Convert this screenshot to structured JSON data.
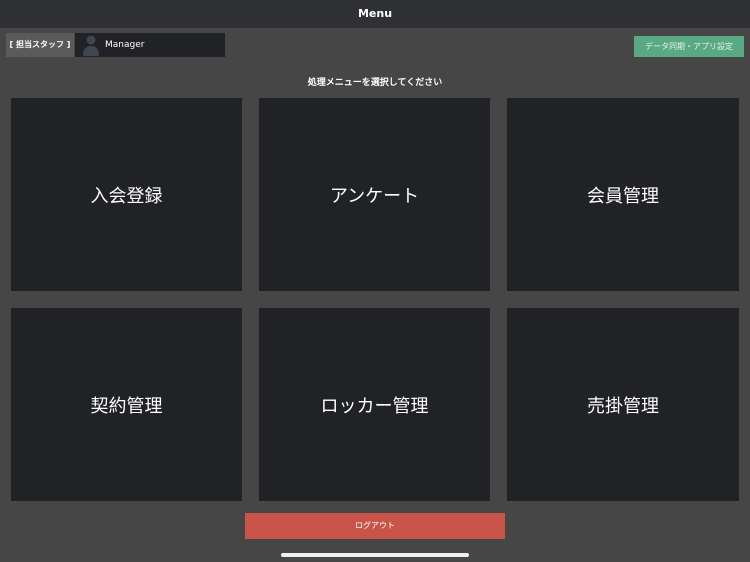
{
  "header": {
    "title": "Menu"
  },
  "staff": {
    "label": "[ 担当スタッフ ]",
    "name": "Manager"
  },
  "sync_button": {
    "label": "データ同期・アプリ設定",
    "color": "#5aa985"
  },
  "prompt": "処理メニューを選択してください",
  "menu": [
    {
      "label": "入会登録"
    },
    {
      "label": "アンケート"
    },
    {
      "label": "会員管理"
    },
    {
      "label": "契約管理"
    },
    {
      "label": "ロッカー管理"
    },
    {
      "label": "売掛管理"
    }
  ],
  "logout": {
    "label": "ログアウト",
    "color": "#c9554a"
  }
}
